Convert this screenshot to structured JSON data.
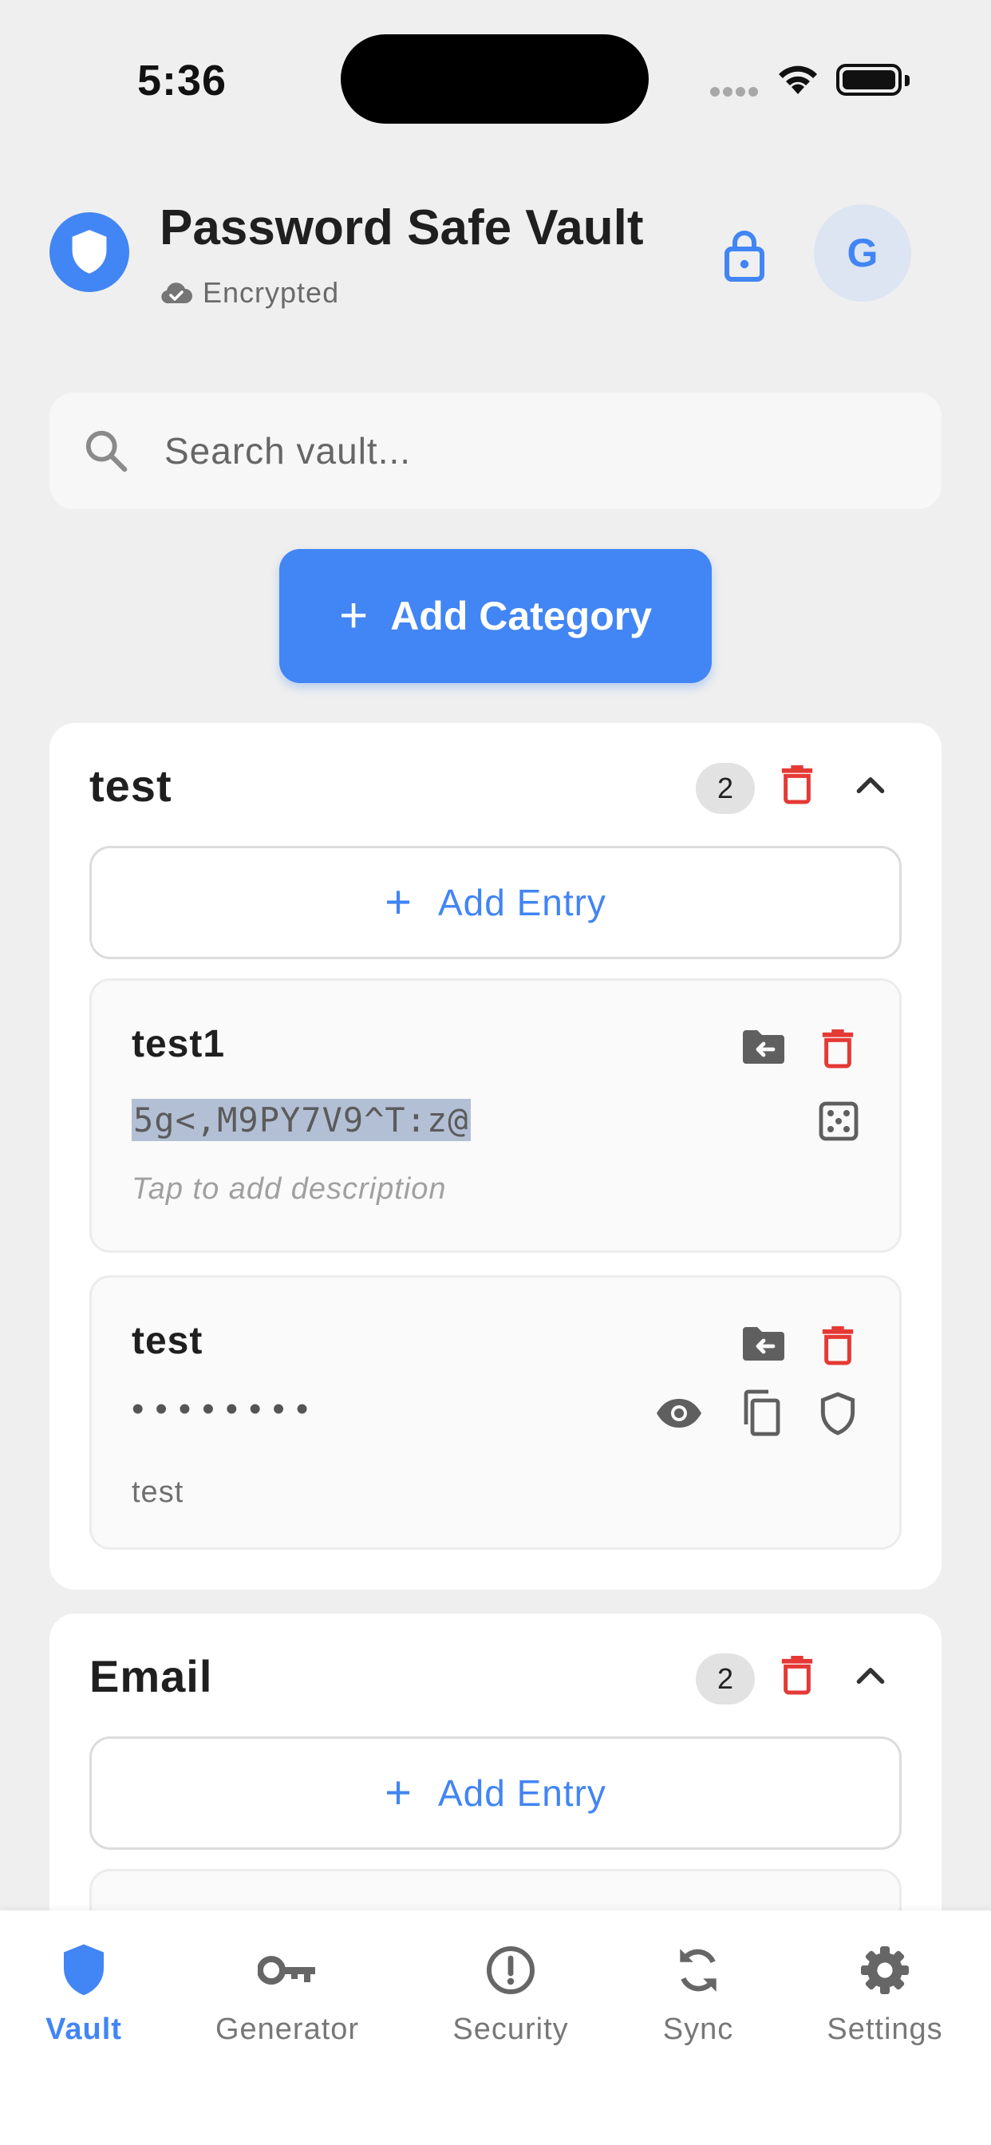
{
  "status_bar": {
    "time": "5:36"
  },
  "header": {
    "title": "Password Safe Vault",
    "status": "Encrypted",
    "avatar_initial": "G"
  },
  "search": {
    "placeholder": "Search vault..."
  },
  "add_category_label": "Add Category",
  "categories": [
    {
      "name": "test",
      "count": "2",
      "add_entry_label": "Add Entry",
      "entries": [
        {
          "name": "test1",
          "password": "5g<,M9PY7V9^T:z@",
          "description_placeholder": "Tap to add description"
        },
        {
          "name": "test",
          "password_masked": "••••••••",
          "description": "test"
        }
      ]
    },
    {
      "name": "Email",
      "count": "2",
      "add_entry_label": "Add Entry"
    }
  ],
  "bottom_nav": [
    {
      "label": "Vault",
      "active": true
    },
    {
      "label": "Generator"
    },
    {
      "label": "Security"
    },
    {
      "label": "Sync"
    },
    {
      "label": "Settings"
    }
  ],
  "colors": {
    "accent": "#4285f4",
    "danger": "#e53935",
    "background": "#efefef"
  }
}
